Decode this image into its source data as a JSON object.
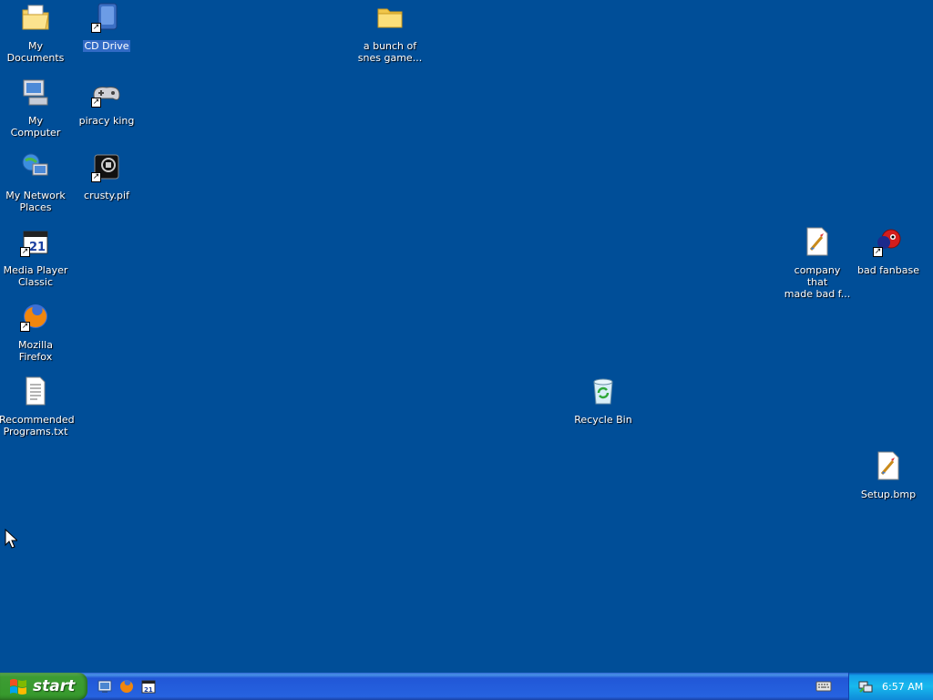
{
  "desktop": {
    "background_color": "#004e98",
    "icons": [
      {
        "label": "My Documents",
        "icon": "my-documents-icon",
        "shortcut": false,
        "selected": false
      },
      {
        "label": "CD Drive",
        "icon": "cd-drive-icon",
        "shortcut": true,
        "selected": true
      },
      {
        "label": "a bunch of\nsnes game...",
        "icon": "folder-icon",
        "shortcut": false,
        "selected": false
      },
      {
        "label": "My Computer",
        "icon": "my-computer-icon",
        "shortcut": false,
        "selected": false
      },
      {
        "label": "piracy king",
        "icon": "gamepad-icon",
        "shortcut": true,
        "selected": false
      },
      {
        "label": "My Network\nPlaces",
        "icon": "network-places-icon",
        "shortcut": false,
        "selected": false
      },
      {
        "label": "crusty.pif",
        "icon": "pif-icon",
        "shortcut": true,
        "selected": false
      },
      {
        "label": "Media Player\nClassic",
        "icon": "media-player-classic-icon",
        "shortcut": true,
        "selected": false
      },
      {
        "label": "company that\nmade bad f...",
        "icon": "bitmap-file-icon",
        "shortcut": false,
        "selected": false
      },
      {
        "label": "bad fanbase",
        "icon": "red-character-icon",
        "shortcut": true,
        "selected": false
      },
      {
        "label": "Mozilla Firefox",
        "icon": "firefox-icon",
        "shortcut": true,
        "selected": false
      },
      {
        "label": "Recommended\nPrograms.txt",
        "icon": "text-file-icon",
        "shortcut": false,
        "selected": false
      },
      {
        "label": "Recycle Bin",
        "icon": "recycle-bin-icon",
        "shortcut": false,
        "selected": false
      },
      {
        "label": "Setup.bmp",
        "icon": "bitmap-file-icon",
        "shortcut": false,
        "selected": false
      }
    ]
  },
  "taskbar": {
    "start_label": "start",
    "quick_launch": [
      "show-desktop-icon",
      "firefox-icon",
      "media-player-classic-icon"
    ],
    "tray_icons": [
      "keyboard-icon",
      "network-icon"
    ],
    "clock": "6:57 AM"
  }
}
